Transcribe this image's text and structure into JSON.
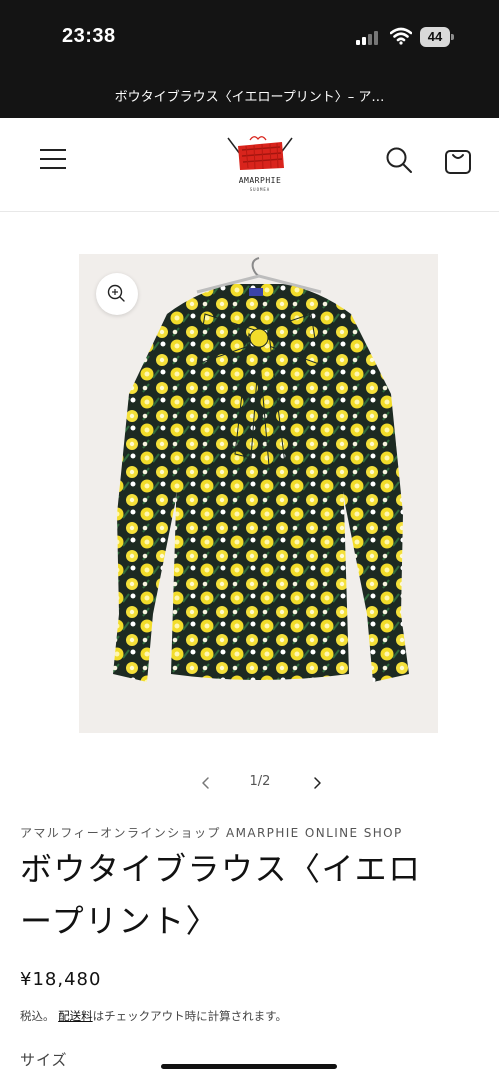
{
  "status_bar": {
    "time": "23:38",
    "battery": "44",
    "icons": [
      "cellular-signal-icon",
      "wifi-icon",
      "battery-icon"
    ]
  },
  "browser": {
    "page_title": "ボウタイブラウス〈イエロープリント〉– ア…"
  },
  "header": {
    "logo_text": "AMARPHIE",
    "logo_sub": "SUOMEA",
    "icons": [
      "hamburger-menu-icon",
      "search-icon",
      "shopping-bag-icon"
    ]
  },
  "gallery": {
    "counter": "1/2",
    "icons": [
      "zoom-in-icon",
      "chevron-left-icon",
      "chevron-right-icon"
    ]
  },
  "product": {
    "vendor": "アマルフィーオンラインショップ AMARPHIE ONLINE SHOP",
    "title_line1": "ボウタイブラウス〈イエロ",
    "title_line2": "ープリント〉",
    "price": "¥18,480",
    "tax_prefix": "税込。",
    "shipping_link": "配送料",
    "tax_suffix": "はチェックアウト時に計算されます。",
    "size_label": "サイズ"
  },
  "colors": {
    "print_yellow": "#f2dc2a",
    "print_ground": "#1d2a22",
    "logo_red": "#d9241c"
  }
}
